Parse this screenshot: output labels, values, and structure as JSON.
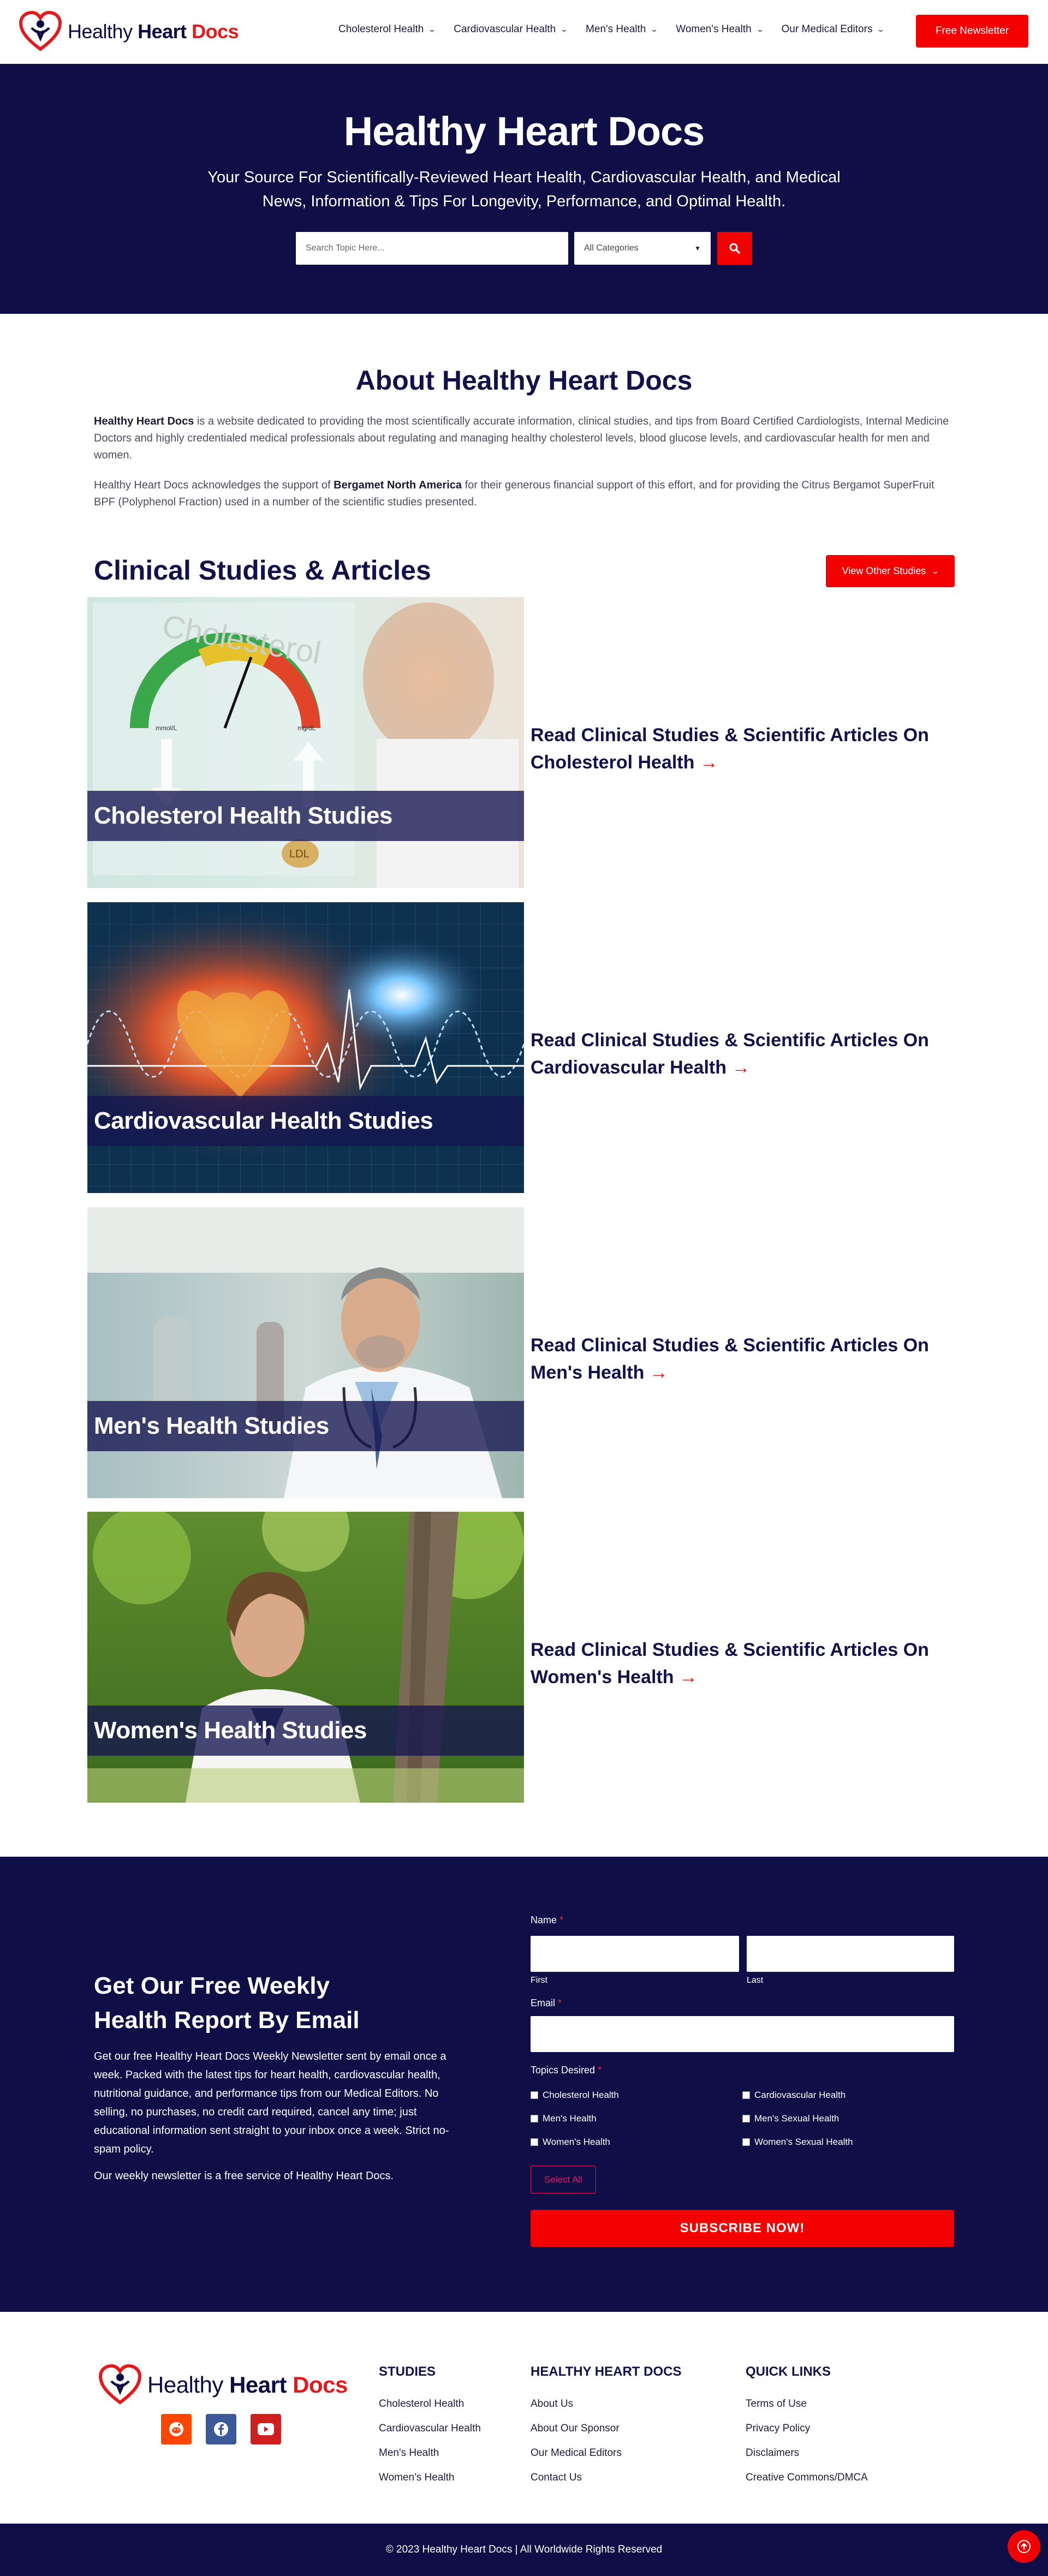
{
  "brand": {
    "name_part1": "Healthy ",
    "name_part2": "Heart",
    "name_part3": " Docs"
  },
  "nav": {
    "items": [
      {
        "label": "Cholesterol Health"
      },
      {
        "label": "Cardiovascular Health"
      },
      {
        "label": "Men's Health"
      },
      {
        "label": "Women's Health"
      },
      {
        "label": "Our Medical Editors"
      }
    ],
    "newsletter_button": "Free Newsletter"
  },
  "hero": {
    "title": "Healthy Heart Docs",
    "subtitle": "Your Source For Scientifically-Reviewed Heart Health, Cardiovascular Health, and Medical News, Information & Tips For Longevity, Performance, and Optimal Health.",
    "search_placeholder": "Search Topic Here...",
    "category_selected": "All Categories"
  },
  "about": {
    "title": "About Healthy Heart Docs",
    "p1_bold": "Healthy Heart Docs",
    "p1_rest": " is a website dedicated to providing the most scientifically accurate information, clinical studies, and tips from Board Certified Cardiologists, Internal Medicine Doctors and highly credentialed medical professionals about regulating and managing healthy cholesterol levels, blood glucose levels, and cardiovascular health for men and women.",
    "p2_start": "Healthy Heart Docs acknowledges the support of ",
    "p2_bold": "Bergamet North America",
    "p2_rest": " for their generous financial support of this effort, and for providing the Citrus Bergamot SuperFruit BPF (Polyphenol Fraction) used in a number of the scientific studies presented."
  },
  "studies": {
    "title": "Clinical Studies & Articles",
    "view_button": "View Other Studies",
    "items": [
      {
        "label": "Cholesterol Health Studies",
        "link_line1": "Read Clinical Studies & Scientific Articles On",
        "link_line2": "Cholesterol Health"
      },
      {
        "label": "Cardiovascular Health Studies",
        "link_line1": "Read Clinical Studies & Scientific Articles On",
        "link_line2": "Cardiovascular Health"
      },
      {
        "label": "Men's Health Studies",
        "link_line1": "Read Clinical Studies & Scientific Articles On",
        "link_line2": "Men's Health"
      },
      {
        "label": "Women's Health Studies",
        "link_line1": "Read Clinical Studies & Scientific Articles On",
        "link_line2": "Women's Health"
      }
    ],
    "gauge_text": "Cholesterol",
    "gauge_left": "mmol/L",
    "gauge_right": "mg/dL",
    "pill_ldl": "LDL"
  },
  "newsletter": {
    "title_line1": "Get Our Free Weekly",
    "title_line2": "Health Report By Email",
    "body": "Get our free Healthy Heart Docs Weekly Newsletter sent by email once a week. Packed with the latest tips for heart health, cardiovascular health, nutritional guidance, and performance tips from our Medical Editors. No selling, no purchases, no credit card required, cancel any time; just educational information sent straight to your inbox once a week. Strict no-spam policy.",
    "note": "Our weekly newsletter is a free service of Healthy Heart Docs.",
    "name_label": "Name",
    "first_label": "First",
    "last_label": "Last",
    "email_label": "Email",
    "topics_label": "Topics Desired",
    "required_mark": "*",
    "topics": [
      "Cholesterol Health",
      "Cardiovascular Health",
      "Men's Health",
      "Men's Sexual Health",
      "Women's Health",
      "Women's Sexual Health"
    ],
    "select_all": "Select All",
    "subscribe": "SUBSCRIBE NOW!"
  },
  "footer": {
    "cols": [
      {
        "title": "STUDIES",
        "links": [
          "Cholesterol Health",
          "Cardiovascular Health",
          "Men's Health",
          "Women's Health"
        ]
      },
      {
        "title": "HEALTHY HEART DOCS",
        "links": [
          "About Us",
          "About Our Sponsor",
          "Our Medical Editors",
          "Contact Us"
        ]
      },
      {
        "title": "QUICK LINKS",
        "links": [
          "Terms of Use",
          "Privacy Policy",
          "Disclaimers",
          "Creative Commons/DMCA"
        ]
      }
    ],
    "socials": [
      "reddit-icon",
      "facebook-icon",
      "youtube-icon"
    ],
    "copyright": "© 2023 Healthy Heart Docs | All Worldwide Rights Reserved"
  },
  "colors": {
    "navy": "#0f0e47",
    "red": "#f50000"
  }
}
